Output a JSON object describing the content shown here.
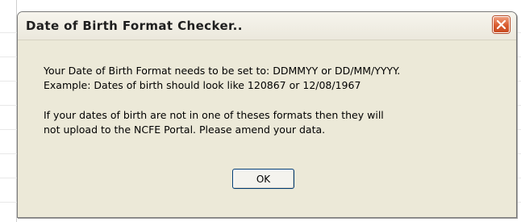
{
  "background": {
    "partial_text": "..."
  },
  "dialog": {
    "title": "Date of Birth Format Checker..",
    "close_icon": "close-icon",
    "message_lines": [
      "Your Date of Birth Format needs to be set to: DDMMYY or DD/MM/YYYY.",
      "Example: Dates of birth should look like 120867 or 12/08/1967",
      "If your dates of birth are not in one of theses formats then they will",
      "not upload to the NCFE Portal.  Please amend your data."
    ],
    "ok_label": "OK"
  },
  "colors": {
    "dialog_face": "#ece9d8",
    "close_button": "#d95b30",
    "ok_border": "#003c74"
  }
}
